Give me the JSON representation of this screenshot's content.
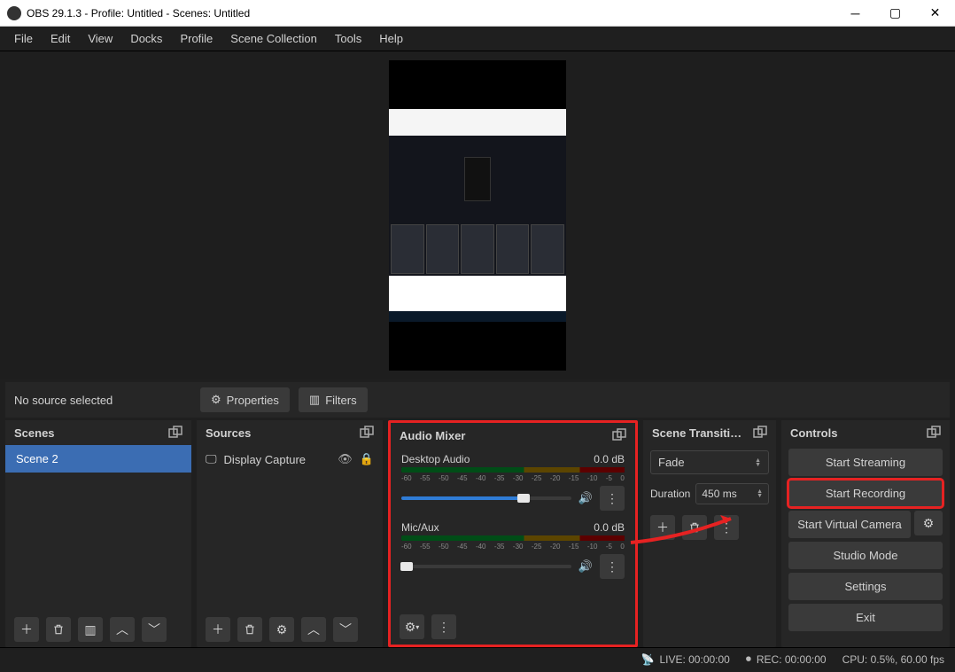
{
  "window": {
    "title": "OBS 29.1.3 - Profile: Untitled - Scenes: Untitled"
  },
  "menu": [
    "File",
    "Edit",
    "View",
    "Docks",
    "Profile",
    "Scene Collection",
    "Tools",
    "Help"
  ],
  "sourcebar": {
    "label": "No source selected",
    "properties": "Properties",
    "filters": "Filters"
  },
  "panels": {
    "scenes": {
      "title": "Scenes",
      "items": [
        "Scene 2"
      ]
    },
    "sources": {
      "title": "Sources",
      "items": [
        {
          "label": "Display Capture"
        }
      ]
    },
    "audio": {
      "title": "Audio Mixer",
      "tracks": [
        {
          "name": "Desktop Audio",
          "level": "0.0 dB"
        },
        {
          "name": "Mic/Aux",
          "level": "0.0 dB"
        }
      ],
      "ticks": [
        "-60",
        "-55",
        "-50",
        "-45",
        "-40",
        "-35",
        "-30",
        "-25",
        "-20",
        "-15",
        "-10",
        "-5",
        "0"
      ]
    },
    "transitions": {
      "title": "Scene Transiti…",
      "selected": "Fade",
      "duration_label": "Duration",
      "duration": "450 ms"
    },
    "controls": {
      "title": "Controls",
      "start_streaming": "Start Streaming",
      "start_recording": "Start Recording",
      "start_virtual_camera": "Start Virtual Camera",
      "studio_mode": "Studio Mode",
      "settings": "Settings",
      "exit": "Exit"
    }
  },
  "status": {
    "live": "LIVE: 00:00:00",
    "rec": "REC: 00:00:00",
    "cpu": "CPU: 0.5%, 60.00 fps"
  }
}
